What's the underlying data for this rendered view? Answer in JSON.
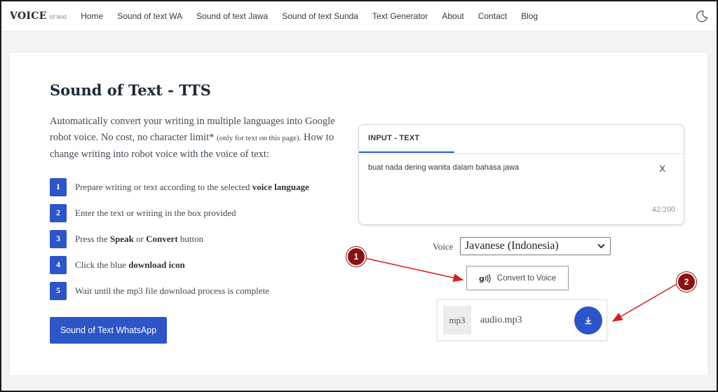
{
  "nav": {
    "brand": "VOICE",
    "brand_sub": "of text",
    "links": [
      "Home",
      "Sound of text WA",
      "Sound of text Jawa",
      "Sound of text Sunda",
      "Text Generator",
      "About",
      "Contact",
      "Blog"
    ]
  },
  "main": {
    "title": "Sound of Text - TTS",
    "intro_1": "Automatically convert your writing in multiple languages into Google robot voice. No cost, no character limit* ",
    "intro_small": "(only for text on this page).",
    "intro_2": " How to change writing into robot voice with the voice of text:",
    "steps": [
      {
        "num": "1",
        "pre": "Prepare writing or text according to the selected ",
        "bold": "voice language",
        "post": ""
      },
      {
        "num": "2",
        "pre": "Enter the text or writing in the box provided",
        "bold": "",
        "post": ""
      },
      {
        "num": "3",
        "pre": "Press the ",
        "bold": "Speak",
        "mid": " or ",
        "bold2": "Convert",
        "post": " button"
      },
      {
        "num": "4",
        "pre": "Click the blue ",
        "bold": "download icon",
        "post": ""
      },
      {
        "num": "5",
        "pre": "Wait until the mp3 file download process is complete",
        "bold": "",
        "post": ""
      }
    ],
    "wa_button": "Sound of Text WhatsApp"
  },
  "input_panel": {
    "tab": "INPUT - TEXT",
    "text": "buat nada dering wanita dalam bahasa jawa",
    "clear": "X",
    "count": "42/200"
  },
  "voice": {
    "label": "Voice",
    "selected": "Javanese (Indonesia)"
  },
  "convert_button": "Convert to Voice",
  "audio": {
    "badge": "mp3",
    "filename": "audio.mp3"
  },
  "annotations": {
    "marker_1": "1",
    "marker_2": "2",
    "color": "#d42020"
  },
  "colors": {
    "accent": "#2d55c8",
    "marker": "#8b1212"
  }
}
